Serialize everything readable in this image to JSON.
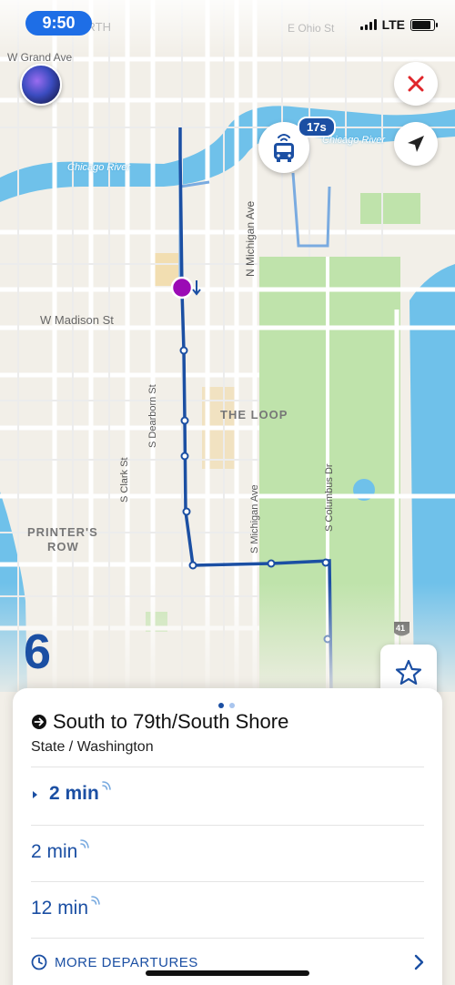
{
  "status_bar": {
    "time": "9:50",
    "network": "LTE"
  },
  "map": {
    "labels": {
      "north": "NORTH",
      "ohio": "E Ohio St",
      "grand": "W Grand Ave",
      "chicago_river_left": "Chicago River",
      "chicago_river_right": "Chicago River",
      "n_michigan": "N Michigan Ave",
      "madison": "W Madison St",
      "dearborn": "S Dearborn St",
      "clark": "S Clark St",
      "the_loop": "THE LOOP",
      "s_michigan": "S Michigan Ave",
      "columbus": "S Columbus Dr",
      "printers_row_1": "PRINTER'S",
      "printers_row_2": "ROW",
      "highway_shield": "41"
    },
    "route_number": "6",
    "bus_eta": "17s",
    "colors": {
      "route": "#1b4fa3",
      "stop_marker": "#9b0bb5",
      "water": "#6fc1ea",
      "park": "#b7dfa3"
    }
  },
  "buttons": {
    "siri_icon": "siri-orb",
    "close_icon": "close-x-red",
    "locate_icon": "location-arrow",
    "bus_icon": "bus-realtime",
    "favorite_icon": "star-outline"
  },
  "sheet": {
    "pages": 2,
    "active_page": 1,
    "direction": "South to 79th/South Shore",
    "stop": "State / Washington",
    "departures": [
      {
        "time": "2 min",
        "next": true
      },
      {
        "time": "2 min",
        "next": false
      },
      {
        "time": "12 min",
        "next": false
      }
    ],
    "more_label": "MORE DEPARTURES"
  }
}
